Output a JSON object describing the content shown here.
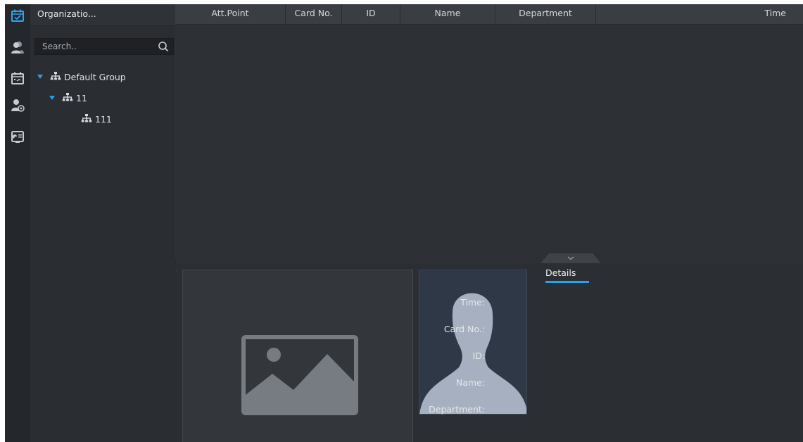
{
  "rail": {
    "items": [
      {
        "name": "attendance-record",
        "active": true
      },
      {
        "name": "person-management",
        "active": false
      },
      {
        "name": "attendance-schedule",
        "active": false
      },
      {
        "name": "person-settings",
        "active": false
      },
      {
        "name": "attendance-report",
        "active": false
      }
    ],
    "active_color": "#2ea3f2",
    "icon_color": "#c7cbd0"
  },
  "org_panel": {
    "title": "Organizatio...",
    "search_placeholder": "Search..",
    "tree": [
      {
        "label": "Default Group",
        "expanded": true,
        "level": 0
      },
      {
        "label": "11",
        "expanded": true,
        "level": 1
      },
      {
        "label": "111",
        "expanded": false,
        "level": 2
      }
    ]
  },
  "table": {
    "columns": [
      "Att.Point",
      "Card No.",
      "ID",
      "Name",
      "Department",
      "Time"
    ],
    "rows": []
  },
  "detail": {
    "tab_label": "Details",
    "fields": {
      "time_label": "Time:",
      "card_label": "Card No.:",
      "id_label": "ID:",
      "name_label": "Name:",
      "department_label": "Department:"
    }
  },
  "colors": {
    "accent": "#22a5f0",
    "background": "#2d3035",
    "header": "#3a3d42"
  }
}
